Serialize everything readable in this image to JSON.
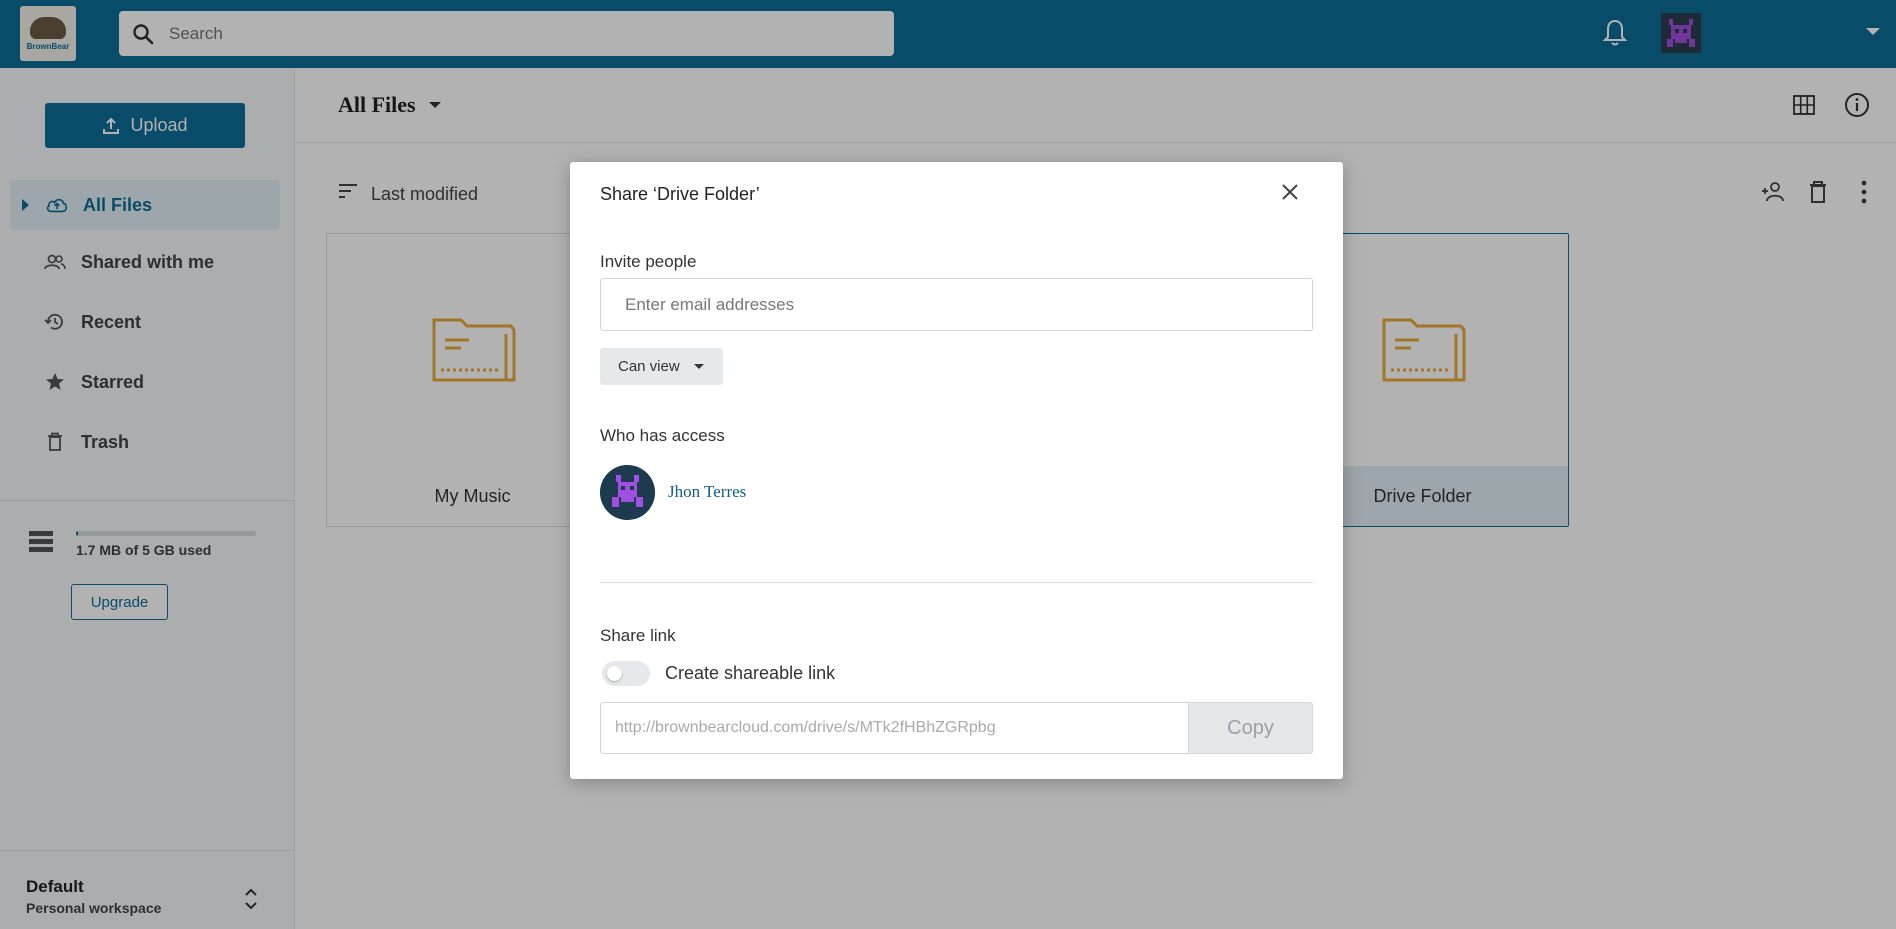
{
  "header": {
    "logo_text": "BrownBear",
    "search_placeholder": "Search"
  },
  "sidebar": {
    "upload_label": "Upload",
    "items": [
      {
        "label": "All Files",
        "icon": "cloud-upload-icon",
        "active": true
      },
      {
        "label": "Shared with me",
        "icon": "people-icon"
      },
      {
        "label": "Recent",
        "icon": "history-icon"
      },
      {
        "label": "Starred",
        "icon": "star-icon"
      },
      {
        "label": "Trash",
        "icon": "trash-icon"
      }
    ],
    "storage": {
      "text": "1.7 MB of 5 GB used",
      "used_fraction": 0.0003
    },
    "upgrade_label": "Upgrade",
    "workspace": {
      "name": "Default",
      "subtitle": "Personal workspace"
    }
  },
  "main": {
    "title": "All Files",
    "sort_label": "Last modified",
    "folders": [
      {
        "name": "My Music"
      },
      {
        "name": "Drive Folder",
        "selected": true
      }
    ]
  },
  "modal": {
    "title": "Share ‘Drive Folder’",
    "invite_label": "Invite people",
    "email_placeholder": "Enter email addresses",
    "permission": "Can view",
    "access_label": "Who has access",
    "user_name": "Jhon Terres",
    "share_link_label": "Share link",
    "toggle_label": "Create shareable link",
    "toggle_on": false,
    "link_value": "http://brownbearcloud.com/drive/s/MTk2fHBhZGRpbg",
    "copy_label": "Copy"
  },
  "colors": {
    "brand": "#0e6e99",
    "folder": "#e8a838",
    "avatar_purple": "#a050e0"
  }
}
